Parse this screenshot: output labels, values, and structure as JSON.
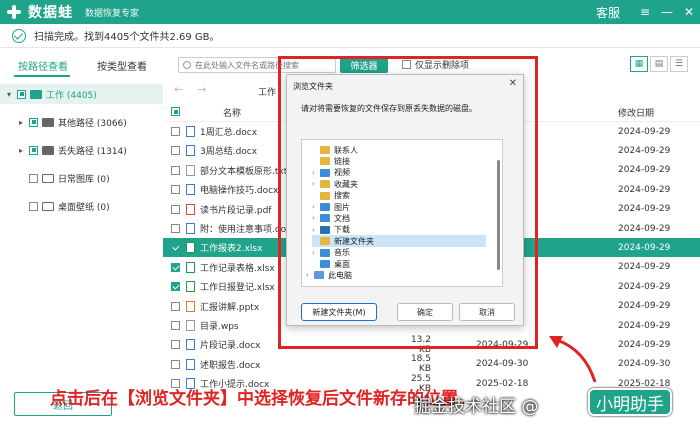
{
  "app": {
    "name": "数据蛙",
    "subtitle": "数据恢复专家",
    "service": "客服",
    "win_buttons": [
      "≡",
      "—",
      "✕"
    ]
  },
  "scan": {
    "status": "扫描完成。找到4405个文件共2.69 GB。"
  },
  "tabs": {
    "by_path": "按路径查看",
    "by_type": "按类型查看"
  },
  "search": {
    "placeholder": "在此处输入文件名或路径搜索"
  },
  "filter_label": "筛选器",
  "deleted_only_label": "仅显示删除项",
  "view_icons": [
    "grid-view-icon",
    "list-view-icon",
    "detail-view-icon"
  ],
  "sidebar": {
    "items": [
      {
        "label": "工作 (4405)",
        "caret": "▾"
      },
      {
        "label": "其他路径 (3066)",
        "caret": "▸"
      },
      {
        "label": "丢失路径 (1314)",
        "caret": "▸"
      },
      {
        "label": "日常图库 (0)",
        "caret": ""
      },
      {
        "label": "桌面壁纸 (0)",
        "caret": ""
      }
    ]
  },
  "content": {
    "breadcrumb": "工作",
    "col_name": "名称",
    "col_modified": "修改日期",
    "rows": [
      {
        "name": "1周汇总.docx",
        "size": "",
        "date": "",
        "modified": "2024-09-29"
      },
      {
        "name": "3周总结.docx",
        "size": "",
        "date": "",
        "modified": "2024-09-29"
      },
      {
        "name": "部分文本模板原形.txt",
        "size": "",
        "date": "",
        "modified": "2024-09-29"
      },
      {
        "name": "电脑操作技巧.docx",
        "size": "",
        "date": "",
        "modified": "2024-09-29"
      },
      {
        "name": "读书片段记录.pdf",
        "size": "",
        "date": "",
        "modified": "2024-09-29"
      },
      {
        "name": "附：使用注意事项.docx",
        "size": "",
        "date": "",
        "modified": "2024-09-29"
      },
      {
        "name": "工作报表2.xlsx",
        "size": "",
        "date": "",
        "modified": "2024-09-29"
      },
      {
        "name": "工作记录表格.xlsx",
        "size": "",
        "date": "",
        "modified": "2024-09-29"
      },
      {
        "name": "工作日报登记.xlsx",
        "size": "",
        "date": "",
        "modified": "2024-09-29"
      },
      {
        "name": "汇报讲解.pptx",
        "size": "",
        "date": "",
        "modified": "2024-09-29"
      },
      {
        "name": "目录.wps",
        "size": "",
        "date": "",
        "modified": "2024-09-29"
      },
      {
        "name": "片段记录.docx",
        "size": "13.2 KB",
        "date": "2024-09-29",
        "modified": "2024-09-29"
      },
      {
        "name": "述职报告.docx",
        "size": "18.5 KB",
        "date": "2024-09-30",
        "modified": "2024-09-30"
      },
      {
        "name": "工作小提示.docx",
        "size": "25.5 KB",
        "date": "2025-02-18",
        "modified": "2025-02-18"
      }
    ]
  },
  "dialog": {
    "title": "浏览文件夹",
    "close": "✕",
    "description": "请对将需要恢复的文件保存到原丢失数据的磁盘。",
    "tree": [
      {
        "label": "联系人",
        "chev": ""
      },
      {
        "label": "链接",
        "chev": ""
      },
      {
        "label": "视频",
        "chev": "›"
      },
      {
        "label": "收藏夹",
        "chev": "›"
      },
      {
        "label": "搜索",
        "chev": ""
      },
      {
        "label": "图片",
        "chev": "›"
      },
      {
        "label": "文档",
        "chev": "›"
      },
      {
        "label": "下载",
        "chev": "›"
      },
      {
        "label": "新建文件夹",
        "chev": ""
      },
      {
        "label": "音乐",
        "chev": "›"
      },
      {
        "label": "桌面",
        "chev": ""
      },
      {
        "label": "此电脑",
        "chev": "›"
      }
    ],
    "new_folder": "新建文件夹(M)",
    "ok": "确定",
    "cancel": "取消"
  },
  "back_button": "返回",
  "annotation": "点击后在【浏览文件夹】中选择恢复后文件新存的位置。",
  "watermark": {
    "text": "掘金技术社区 @",
    "badge": "小明助手"
  },
  "colors": {
    "accent": "#1fa38a",
    "annotation_red": "#e02424"
  }
}
